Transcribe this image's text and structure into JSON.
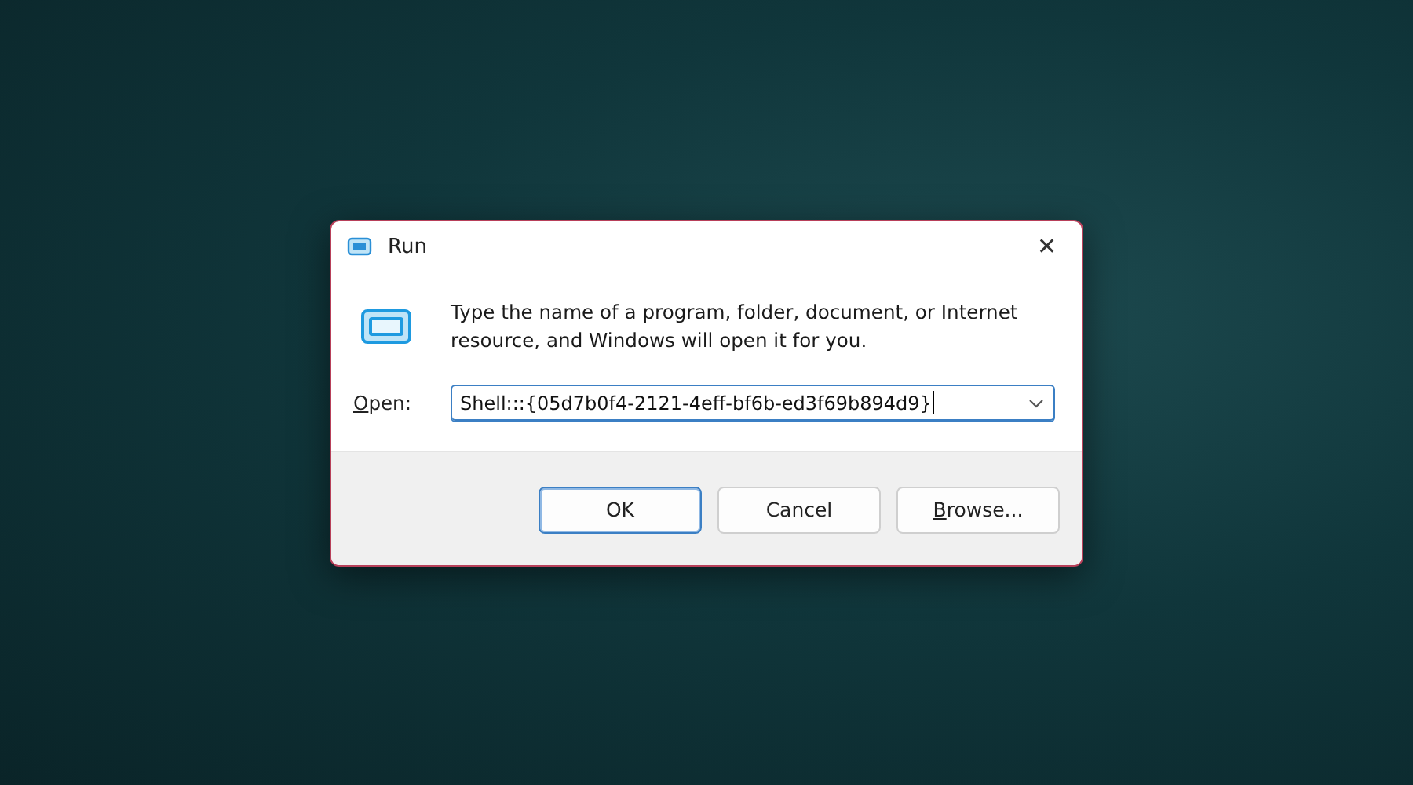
{
  "window": {
    "title": "Run",
    "close": "✕"
  },
  "message": "Type the name of a program, folder, document, or Internet resource, and Windows will open it for you.",
  "open_field": {
    "label": "Open:",
    "label_underline_first": true,
    "value": "Shell:::{05d7b0f4-2121-4eff-bf6b-ed3f69b894d9}",
    "focused": true
  },
  "buttons": [
    {
      "label": "OK",
      "default": true,
      "underline_first": false
    },
    {
      "label": "Cancel",
      "default": false,
      "underline_first": false
    },
    {
      "label": "Browse...",
      "default": false,
      "underline_first": true
    }
  ]
}
